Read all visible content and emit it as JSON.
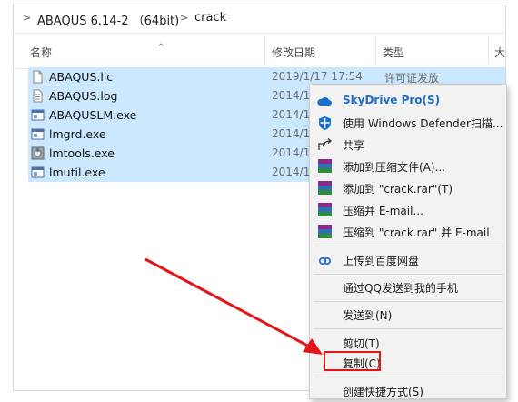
{
  "address": {
    "crumbs": [
      "ABAQUS 6.14-2 （64bit)",
      "crack"
    ],
    "separator": ">"
  },
  "columns": {
    "name": "名称",
    "date": "修改日期",
    "type": "类型",
    "size": "大"
  },
  "files": [
    {
      "name": "ABAQUS.lic",
      "date": "2019/1/17 17:54",
      "type": "许可证发放",
      "icon": "document-icon"
    },
    {
      "name": "ABAQUS.log",
      "date": "2014/1",
      "type": "",
      "icon": "text-file-icon"
    },
    {
      "name": "ABAQUSLM.exe",
      "date": "2014/1",
      "type": "",
      "icon": "exe-icon"
    },
    {
      "name": "lmgrd.exe",
      "date": "2014/1",
      "type": "",
      "icon": "exe-icon"
    },
    {
      "name": "lmtools.exe",
      "date": "2014/1",
      "type": "",
      "icon": "tools-exe-icon"
    },
    {
      "name": "lmutil.exe",
      "date": "2014/1",
      "type": "",
      "icon": "exe-icon"
    }
  ],
  "context_menu": {
    "skydrive": "SkyDrive Pro(S)",
    "defender": "使用 Windows Defender扫描...",
    "share": "共享",
    "add_archive": "添加到压缩文件(A)...",
    "add_rar": "添加到 \"crack.rar\"(T)",
    "compress_email": "压缩并 E-mail...",
    "compress_rar_email": "压缩到 \"crack.rar\" 并 E-mail",
    "baidu": "上传到百度网盘",
    "qq_phone": "通过QQ发送到我的手机",
    "send_to": "发送到(N)",
    "cut": "剪切(T)",
    "copy": "复制(C)",
    "create_shortcut": "创建快捷方式(S)"
  },
  "colors": {
    "selection": "#cce8ff",
    "highlight_box": "#e3151b",
    "arrow": "#e3151b"
  }
}
